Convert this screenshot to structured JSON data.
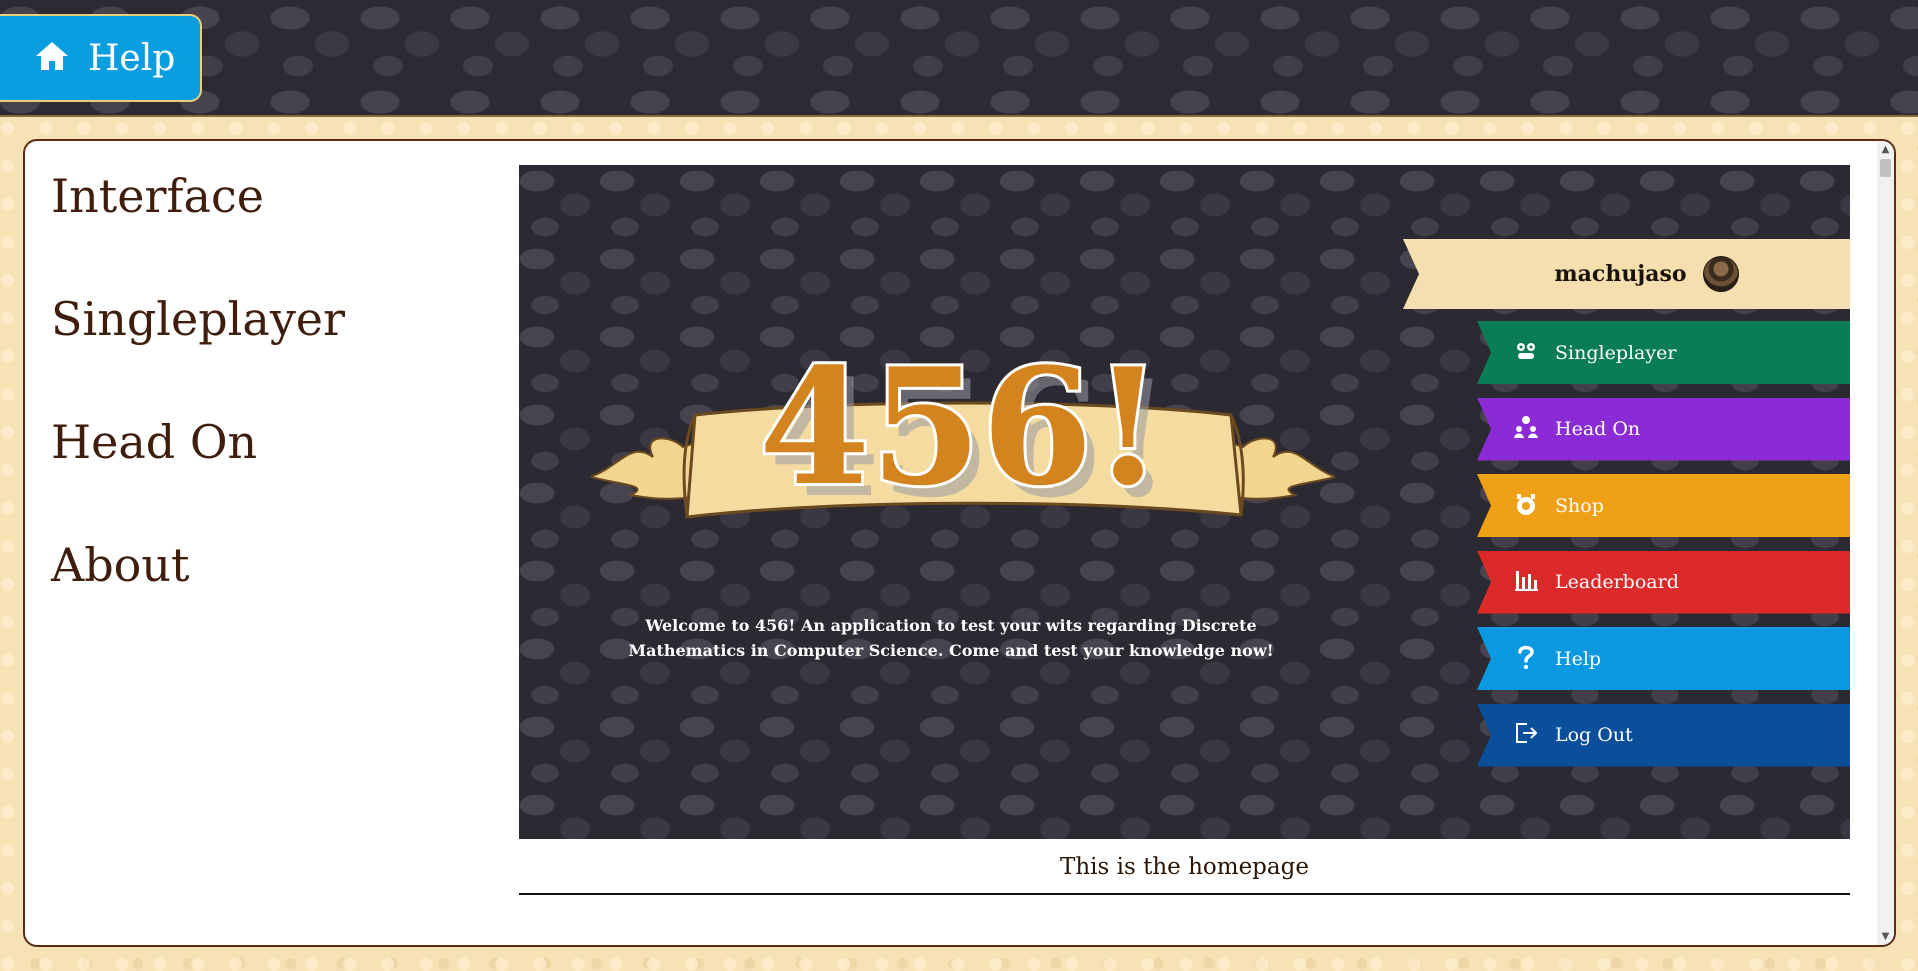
{
  "header": {
    "home_tab_label": "Help",
    "home_icon": "home-icon"
  },
  "side_nav": {
    "items": [
      "Interface",
      "Singleplayer",
      "Head On",
      "About"
    ]
  },
  "preview": {
    "logo_text": "456!",
    "welcome_text": "Welcome to 456! An application to test your wits regarding Discrete Mathematics in Computer Science. Come and test your knowledge now!",
    "username": "machujaso",
    "menu": [
      {
        "label": "Singleplayer",
        "icon": "robot-icon",
        "color": "#0a7d56"
      },
      {
        "label": "Head On",
        "icon": "users-icon",
        "color": "#8a2bd6"
      },
      {
        "label": "Shop",
        "icon": "shop-icon",
        "color": "#f0a014"
      },
      {
        "label": "Leaderboard",
        "icon": "chart-icon",
        "color": "#dc2a2a"
      },
      {
        "label": "Help",
        "icon": "question-icon",
        "color": "#0a98e0"
      },
      {
        "label": "Log Out",
        "icon": "logout-icon",
        "color": "#0b4f9a"
      }
    ]
  },
  "caption": "This is the homepage",
  "colors": {
    "accent_help": "#0a9ee0",
    "text_brown": "#3f1e0d",
    "card_border": "#5a2d14"
  }
}
